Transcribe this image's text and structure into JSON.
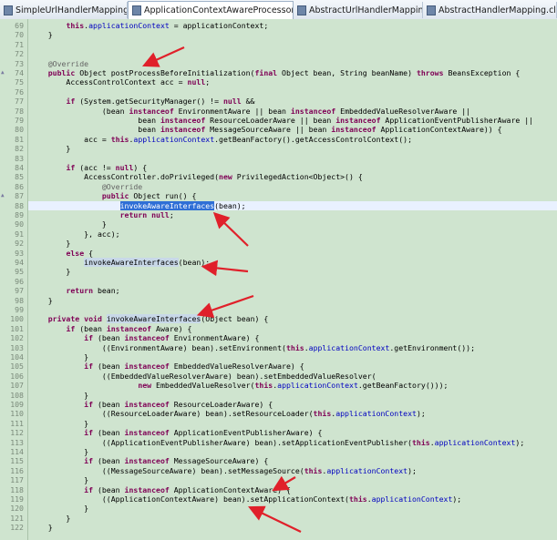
{
  "tabs": [
    {
      "label": "SimpleUrlHandlerMapping.class",
      "active": false
    },
    {
      "label": "ApplicationContextAwareProcessor.class",
      "active": true
    },
    {
      "label": "AbstractUrlHandlerMapping.class",
      "active": false
    },
    {
      "label": "AbstractHandlerMapping.class",
      "active": false
    }
  ],
  "tab_close_glyph": "✕",
  "colors": {
    "editor_bg": "#cfe4cf",
    "keyword": "#7f0055",
    "field": "#0000c0",
    "annotation": "#646464",
    "selection": "#2f6fd6",
    "arrow": "#e0202a"
  },
  "lines": [
    {
      "n": "69",
      "code": "        this.applicationContext = applicationContext;"
    },
    {
      "n": "70",
      "code": "    }"
    },
    {
      "n": "71",
      "code": ""
    },
    {
      "n": "72",
      "code": ""
    },
    {
      "n": "73",
      "code": "    @Override"
    },
    {
      "n": "74",
      "code": "    public Object postProcessBeforeInitialization(final Object bean, String beanName) throws BeansException {",
      "marker": "▲"
    },
    {
      "n": "75",
      "code": "        AccessControlContext acc = null;"
    },
    {
      "n": "76",
      "code": ""
    },
    {
      "n": "77",
      "code": "        if (System.getSecurityManager() != null &&"
    },
    {
      "n": "78",
      "code": "                (bean instanceof EnvironmentAware || bean instanceof EmbeddedValueResolverAware ||"
    },
    {
      "n": "79",
      "code": "                        bean instanceof ResourceLoaderAware || bean instanceof ApplicationEventPublisherAware ||"
    },
    {
      "n": "80",
      "code": "                        bean instanceof MessageSourceAware || bean instanceof ApplicationContextAware)) {"
    },
    {
      "n": "81",
      "code": "            acc = this.applicationContext.getBeanFactory().getAccessControlContext();"
    },
    {
      "n": "82",
      "code": "        }"
    },
    {
      "n": "83",
      "code": ""
    },
    {
      "n": "84",
      "code": "        if (acc != null) {"
    },
    {
      "n": "85",
      "code": "            AccessController.doPrivileged(new PrivilegedAction<Object>() {"
    },
    {
      "n": "86",
      "code": "                @Override"
    },
    {
      "n": "87",
      "code": "                public Object run() {",
      "marker": "▲"
    },
    {
      "n": "88",
      "code": "                    invokeAwareInterfaces(bean);",
      "current": true
    },
    {
      "n": "89",
      "code": "                    return null;"
    },
    {
      "n": "90",
      "code": "                }"
    },
    {
      "n": "91",
      "code": "            }, acc);"
    },
    {
      "n": "92",
      "code": "        }"
    },
    {
      "n": "93",
      "code": "        else {"
    },
    {
      "n": "94",
      "code": "            invokeAwareInterfaces(bean);"
    },
    {
      "n": "95",
      "code": "        }"
    },
    {
      "n": "96",
      "code": ""
    },
    {
      "n": "97",
      "code": "        return bean;"
    },
    {
      "n": "98",
      "code": "    }"
    },
    {
      "n": "99",
      "code": ""
    },
    {
      "n": "100",
      "code": "    private void invokeAwareInterfaces(Object bean) {"
    },
    {
      "n": "101",
      "code": "        if (bean instanceof Aware) {"
    },
    {
      "n": "102",
      "code": "            if (bean instanceof EnvironmentAware) {"
    },
    {
      "n": "103",
      "code": "                ((EnvironmentAware) bean).setEnvironment(this.applicationContext.getEnvironment());"
    },
    {
      "n": "104",
      "code": "            }"
    },
    {
      "n": "105",
      "code": "            if (bean instanceof EmbeddedValueResolverAware) {"
    },
    {
      "n": "106",
      "code": "                ((EmbeddedValueResolverAware) bean).setEmbeddedValueResolver("
    },
    {
      "n": "107",
      "code": "                        new EmbeddedValueResolver(this.applicationContext.getBeanFactory()));"
    },
    {
      "n": "108",
      "code": "            }"
    },
    {
      "n": "109",
      "code": "            if (bean instanceof ResourceLoaderAware) {"
    },
    {
      "n": "110",
      "code": "                ((ResourceLoaderAware) bean).setResourceLoader(this.applicationContext);"
    },
    {
      "n": "111",
      "code": "            }"
    },
    {
      "n": "112",
      "code": "            if (bean instanceof ApplicationEventPublisherAware) {"
    },
    {
      "n": "113",
      "code": "                ((ApplicationEventPublisherAware) bean).setApplicationEventPublisher(this.applicationContext);"
    },
    {
      "n": "114",
      "code": "            }"
    },
    {
      "n": "115",
      "code": "            if (bean instanceof MessageSourceAware) {"
    },
    {
      "n": "116",
      "code": "                ((MessageSourceAware) bean).setMessageSource(this.applicationContext);"
    },
    {
      "n": "117",
      "code": "            }"
    },
    {
      "n": "118",
      "code": "            if (bean instanceof ApplicationContextAware) {"
    },
    {
      "n": "119",
      "code": "                ((ApplicationContextAware) bean).setApplicationContext(this.applicationContext);"
    },
    {
      "n": "120",
      "code": "            }"
    },
    {
      "n": "121",
      "code": "        }"
    },
    {
      "n": "122",
      "code": "    }"
    }
  ]
}
